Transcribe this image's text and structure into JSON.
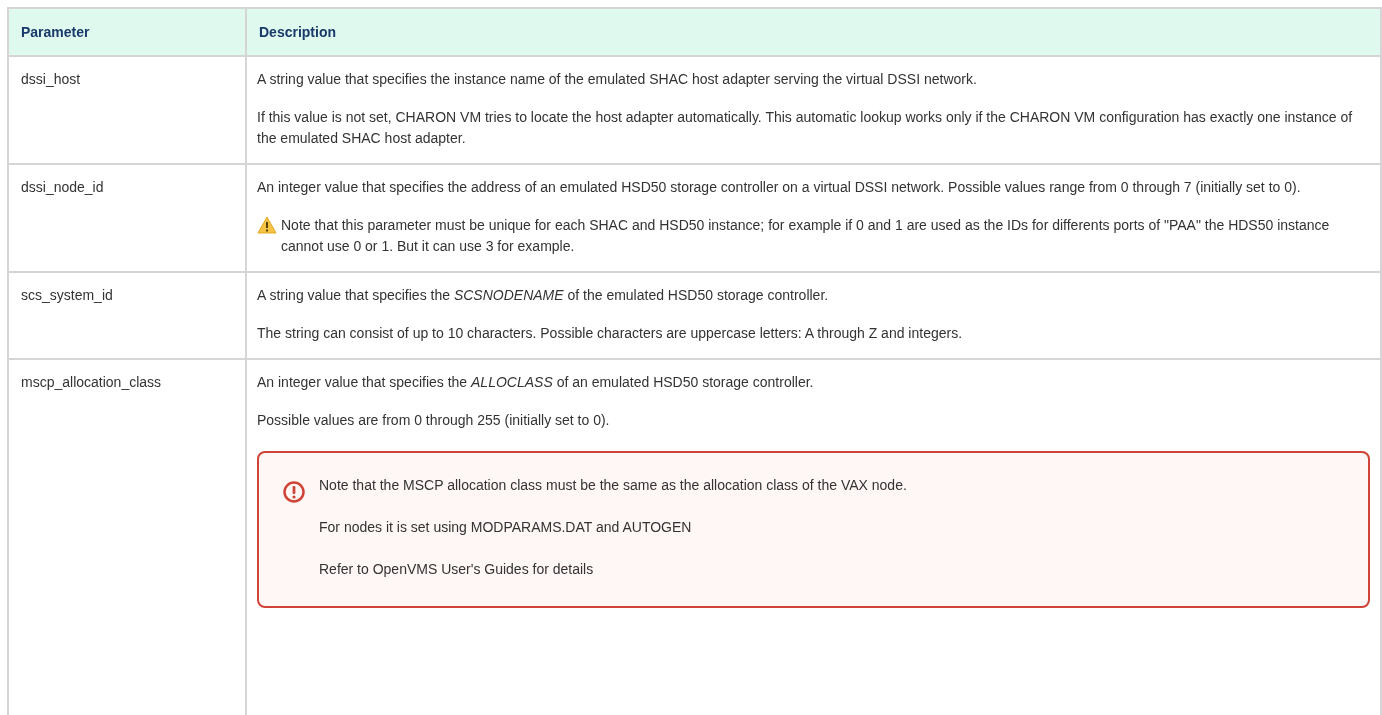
{
  "table": {
    "columns": [
      "Parameter",
      "Description"
    ],
    "rows": [
      {
        "parameter": "dssi_host",
        "blocks": [
          {
            "kind": "text",
            "text": "A string value that specifies the instance name of the emulated SHAC host adapter serving the virtual DSSI network."
          },
          {
            "kind": "text",
            "text": "If this value is not set, CHARON VM tries to locate the host adapter automatically. This automatic lookup works only if the CHARON VM configuration has exactly one instance of the emulated SHAC host adapter."
          }
        ]
      },
      {
        "parameter": "dssi_node_id",
        "blocks": [
          {
            "kind": "text",
            "text": "An integer value that specifies the address of an emulated HSD50 storage controller on a virtual DSSI network. Possible values range from 0 through 7 (initially set to 0)."
          },
          {
            "kind": "warning",
            "text": "Note that this parameter must be unique for each SHAC and HSD50 instance; for example if 0 and 1 are used as the IDs for differents ports of \"PAA\" the HDS50 instance cannot use 0 or 1. But it can use 3 for example."
          }
        ]
      },
      {
        "parameter": "scs_system_id",
        "blocks": [
          {
            "kind": "text",
            "text": "A string value that specifies the *SCSNODENAME* of the emulated HSD50 storage controller."
          },
          {
            "kind": "text",
            "text": "The string can consist of up to 10 characters. Possible characters are uppercase letters: A through Z and integers."
          }
        ]
      },
      {
        "parameter": "mscp_allocation_class",
        "blocks": [
          {
            "kind": "text",
            "text": "An integer value that specifies the *ALLOCLASS* of an emulated HSD50 storage controller."
          },
          {
            "kind": "text",
            "text": "Possible values are from 0 through 255 (initially set to 0)."
          },
          {
            "kind": "error_panel",
            "lines": [
              "Note that the MSCP allocation class must be the same as the allocation class of the VAX node.",
              "For nodes it is set using MODPARAMS.DAT and AUTOGEN",
              "Refer to OpenVMS User's Guides for details"
            ]
          }
        ]
      }
    ]
  }
}
